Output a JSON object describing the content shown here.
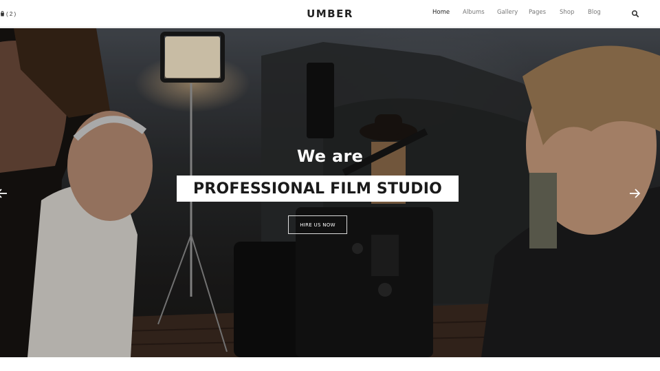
{
  "header": {
    "cart_count": "( 2 )",
    "logo": "UMBER",
    "nav": [
      {
        "label": "Home",
        "active": true
      },
      {
        "label": "Albums",
        "active": false
      },
      {
        "label": "Gallery",
        "active": false
      },
      {
        "label": "Pages",
        "active": false
      },
      {
        "label": "Shop",
        "active": false
      },
      {
        "label": "Blog",
        "active": false
      }
    ],
    "icons": {
      "cart": "cart-icon",
      "search": "search-icon"
    }
  },
  "hero": {
    "kicker": "We are",
    "headline": "PROFESSIONAL FILM STUDIO",
    "cta_label": "HIRE US NOW",
    "icons": {
      "prev": "arrow-left-icon",
      "next": "arrow-right-icon"
    }
  },
  "colors": {
    "text_dark": "#222222",
    "nav_muted": "#777777",
    "white": "#ffffff"
  }
}
